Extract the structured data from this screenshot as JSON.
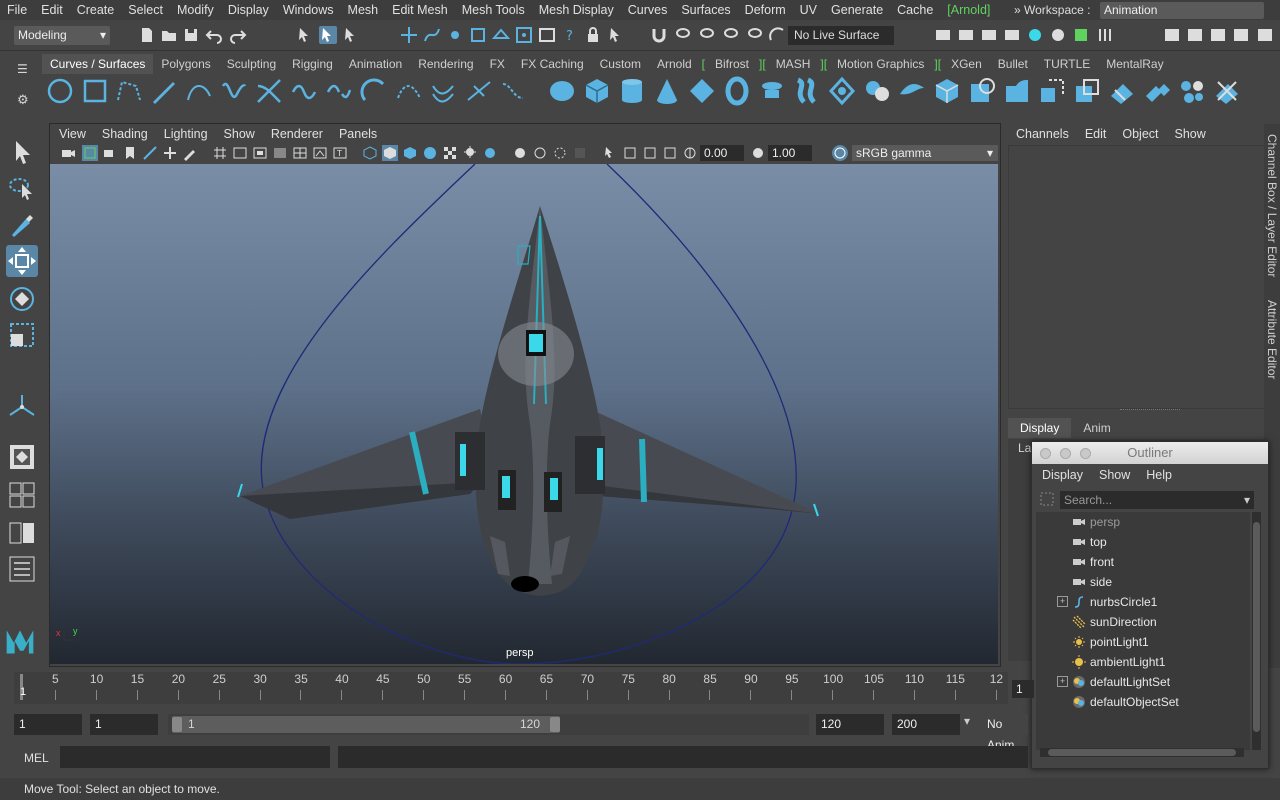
{
  "menubar": {
    "items": [
      "File",
      "Edit",
      "Create",
      "Select",
      "Modify",
      "Display",
      "Windows",
      "Mesh",
      "Edit Mesh",
      "Mesh Tools",
      "Mesh Display",
      "Curves",
      "Surfaces",
      "Deform",
      "UV",
      "Generate",
      "Cache",
      "[Arnold]"
    ],
    "workspace_label": "» Workspace :",
    "workspace_value": "Animation"
  },
  "statusline": {
    "mode": "Modeling",
    "live_surface": "No Live Surface"
  },
  "shelf": {
    "tabs": [
      "Curves / Surfaces",
      "Polygons",
      "Sculpting",
      "Rigging",
      "Animation",
      "Rendering",
      "FX",
      "FX Caching",
      "Custom",
      "Arnold",
      "[",
      "Bifrost",
      "][",
      "MASH",
      "][",
      "Motion Graphics",
      "][",
      "XGen",
      "Bullet",
      "TURTLE",
      "MentalRay"
    ],
    "active_tab": "Curves / Surfaces"
  },
  "viewport": {
    "menu": [
      "View",
      "Shading",
      "Lighting",
      "Show",
      "Renderer",
      "Panels"
    ],
    "exposure": "0.00",
    "gamma": "1.00",
    "color_space": "sRGB gamma",
    "camera": "persp",
    "axis_x": "x",
    "axis_y": "y"
  },
  "channel_box": {
    "menu": [
      "Channels",
      "Edit",
      "Object",
      "Show"
    ],
    "side_tab": "Channel Box / Layer Editor",
    "side_tab2": "Attribute Editor",
    "layer_tabs": [
      "Display",
      "Anim"
    ],
    "layer_label": "La"
  },
  "outliner": {
    "title": "Outliner",
    "menu": [
      "Display",
      "Show",
      "Help"
    ],
    "search_placeholder": "Search...",
    "items": [
      {
        "label": "persp",
        "icon": "camera-icon",
        "dim": true,
        "expandable": false
      },
      {
        "label": "top",
        "icon": "camera-icon",
        "dim": false,
        "expandable": false
      },
      {
        "label": "front",
        "icon": "camera-icon",
        "dim": false,
        "expandable": false
      },
      {
        "label": "side",
        "icon": "camera-icon",
        "dim": false,
        "expandable": false
      },
      {
        "label": "nurbsCircle1",
        "icon": "curve-icon",
        "dim": false,
        "expandable": true
      },
      {
        "label": "sunDirection",
        "icon": "directional-light-icon",
        "dim": false,
        "expandable": false
      },
      {
        "label": "pointLight1",
        "icon": "point-light-icon",
        "dim": false,
        "expandable": false
      },
      {
        "label": "ambientLight1",
        "icon": "ambient-light-icon",
        "dim": false,
        "expandable": false
      },
      {
        "label": "defaultLightSet",
        "icon": "set-icon",
        "dim": false,
        "expandable": true
      },
      {
        "label": "defaultObjectSet",
        "icon": "set-icon",
        "dim": false,
        "expandable": false
      }
    ]
  },
  "timeline": {
    "ticks": [
      "5",
      "10",
      "15",
      "20",
      "25",
      "30",
      "35",
      "40",
      "45",
      "50",
      "55",
      "60",
      "65",
      "70",
      "75",
      "80",
      "85",
      "90",
      "95",
      "100",
      "105",
      "110",
      "115",
      "12"
    ],
    "current_frame": "1",
    "current_frame_box": "1"
  },
  "range": {
    "start": "1",
    "start2": "1",
    "inner_start": "1",
    "inner_end": "120",
    "end": "120",
    "end2": "200",
    "anim_layer": "No Anim"
  },
  "commandline": {
    "label": "MEL"
  },
  "helpline": {
    "text": "Move Tool: Select an object to move."
  },
  "colors": {
    "accent_blue": "#5ab3e0",
    "selected_tool": "#5a87a6",
    "arnold_green": "#5fd35f",
    "ship_cyan": "#3ad8e8"
  }
}
